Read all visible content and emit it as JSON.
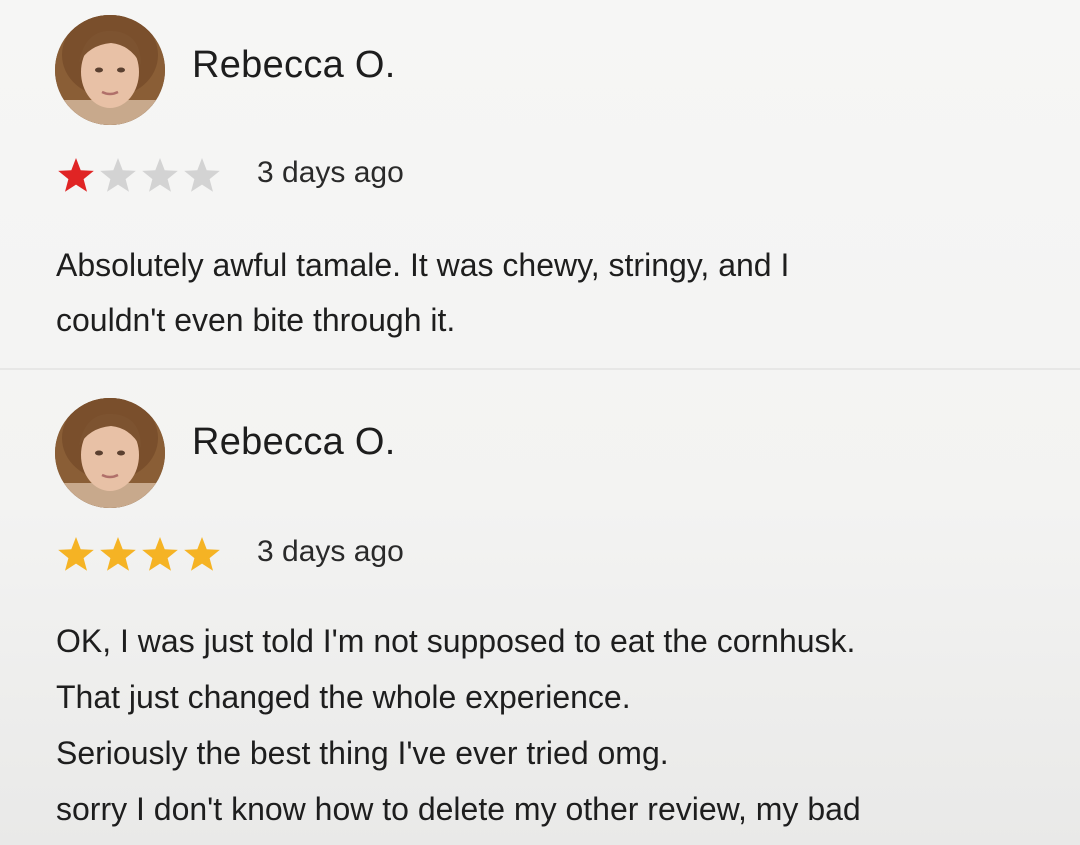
{
  "reviews": [
    {
      "author": "Rebecca O.",
      "rating": 1,
      "max_rating": 4,
      "date": "3 days ago",
      "lines": [
        "Absolutely awful tamale. It was chewy, stringy, and I",
        "couldn't even bite through it."
      ]
    },
    {
      "author": "Rebecca O.",
      "rating": 4,
      "max_rating": 4,
      "date": "3 days ago",
      "lines": [
        "OK, I was just told I'm not supposed to eat the cornhusk.",
        "That just changed the whole experience.",
        "Seriously the best thing I've ever tried omg.",
        "sorry I don't know how to delete my other review, my bad"
      ]
    }
  ],
  "colors": {
    "star_red": "#e02424",
    "star_gold": "#f5b324",
    "star_empty": "#d3d3d3"
  },
  "icons": {
    "star": "star-icon",
    "avatar": "avatar"
  }
}
